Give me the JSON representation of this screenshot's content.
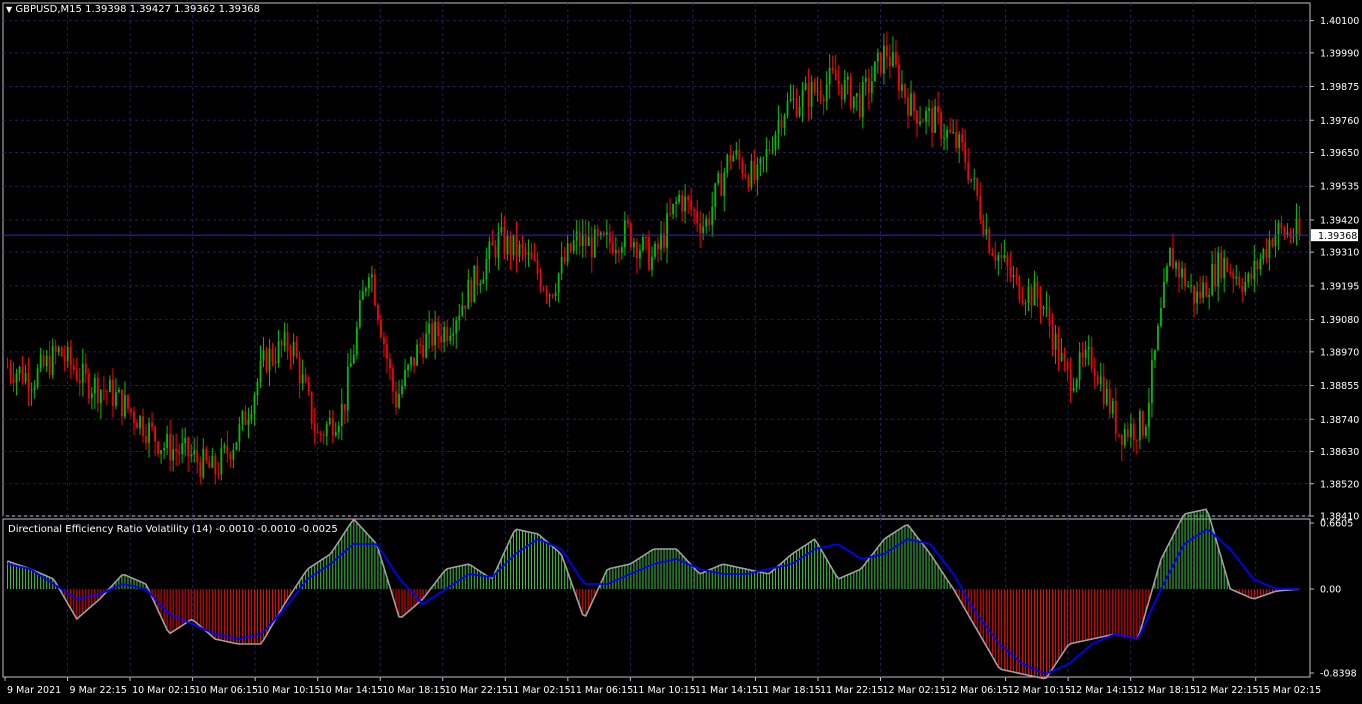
{
  "main_chart": {
    "symbol_label": "GBPUSD,M15",
    "ohlc_label": "1.39398 1.39427 1.39362 1.39368",
    "price_levels": [
      "1.40100",
      "1.39990",
      "1.39875",
      "1.39760",
      "1.39650",
      "1.39535",
      "1.39420",
      "1.39310",
      "1.39195",
      "1.39080",
      "1.38970",
      "1.38855",
      "1.38740",
      "1.38630",
      "1.38520",
      "1.38410"
    ],
    "current_price_label": "1.39368"
  },
  "indicator": {
    "title": "Directional Efficiency Ratio Volatility (14) -0.0010 -0.0010 -0.0025",
    "levels": [
      "0.6605",
      "0.00",
      "-0.8398"
    ]
  },
  "time_labels": [
    "9 Mar 2021",
    "9 Mar 22:15",
    "10 Mar 02:15",
    "10 Mar 06:15",
    "10 Mar 10:15",
    "10 Mar 14:15",
    "10 Mar 18:15",
    "10 Mar 22:15",
    "11 Mar 02:15",
    "11 Mar 06:15",
    "11 Mar 10:15",
    "11 Mar 14:15",
    "11 Mar 18:15",
    "11 Mar 22:15",
    "12 Mar 02:15",
    "12 Mar 06:15",
    "12 Mar 10:15",
    "12 Mar 14:15",
    "12 Mar 18:15",
    "12 Mar 22:15",
    "15 Mar 02:15"
  ],
  "colors": {
    "background": "#000000",
    "grid": "#1c1c6e",
    "bull_candle": "#00c000",
    "bear_candle": "#ff0000",
    "histogram_positive": "#32cd32",
    "histogram_negative": "#ff0000",
    "signal_line": "#0000ff",
    "ratio_line": "#a0a0a0",
    "bid_line": "#2b2bcf",
    "text": "#ffffff"
  },
  "chart_data": [
    {
      "type": "candlestick",
      "title": "GBPUSD,M15",
      "ylim": [
        1.3841,
        1.4016
      ],
      "x": [
        "9 Mar 2021",
        "9 Mar 22:15",
        "10 Mar 02:15",
        "10 Mar 06:15",
        "10 Mar 10:15",
        "10 Mar 14:15",
        "10 Mar 18:15",
        "10 Mar 22:15",
        "11 Mar 02:15",
        "11 Mar 06:15",
        "11 Mar 10:15",
        "11 Mar 14:15",
        "11 Mar 18:15",
        "11 Mar 22:15",
        "12 Mar 02:15",
        "12 Mar 06:15",
        "12 Mar 10:15",
        "12 Mar 14:15",
        "12 Mar 18:15",
        "12 Mar 22:15",
        "15 Mar 02:15"
      ],
      "close_path": [
        1.3892,
        1.3888,
        1.3897,
        1.3887,
        1.3883,
        1.3875,
        1.3865,
        1.3862,
        1.3856,
        1.387,
        1.3895,
        1.39,
        1.3868,
        1.3878,
        1.3928,
        1.388,
        1.39,
        1.3905,
        1.392,
        1.3935,
        1.393,
        1.3918,
        1.3935,
        1.3933,
        1.3938,
        1.3928,
        1.395,
        1.394,
        1.3965,
        1.3955,
        1.398,
        1.3985,
        1.399,
        1.3982,
        1.4,
        1.398,
        1.3975,
        1.3965,
        1.3935,
        1.392,
        1.3915,
        1.3888,
        1.3895,
        1.387,
        1.3872,
        1.393,
        1.3915,
        1.3928,
        1.392,
        1.3938,
        1.3937
      ],
      "current_price": 1.39368,
      "ohlc": {
        "open": 1.39398,
        "high": 1.39427,
        "low": 1.39362,
        "close": 1.39368
      }
    },
    {
      "type": "histogram",
      "title": "Directional Efficiency Ratio Volatility (14)",
      "ylim": [
        -0.8398,
        0.6605
      ],
      "values_shown": [
        -0.001,
        -0.001,
        -0.0025
      ],
      "ratio_path": [
        0.28,
        0.2,
        0.1,
        -0.3,
        -0.1,
        0.15,
        0.05,
        -0.45,
        -0.3,
        -0.5,
        -0.55,
        -0.55,
        -0.15,
        0.2,
        0.35,
        0.7,
        0.45,
        -0.3,
        -0.1,
        0.2,
        0.25,
        0.1,
        0.6,
        0.55,
        0.35,
        -0.3,
        0.2,
        0.25,
        0.4,
        0.4,
        0.15,
        0.25,
        0.2,
        0.15,
        0.35,
        0.5,
        0.1,
        0.2,
        0.5,
        0.65,
        0.35,
        0.0,
        -0.4,
        -0.8,
        -0.85,
        -0.9,
        -0.55,
        -0.5,
        -0.45,
        -0.5,
        0.3,
        0.75,
        0.8,
        0.0,
        -0.1,
        -0.02,
        0.0
      ],
      "signal_path": [
        0.25,
        0.2,
        0.05,
        -0.1,
        -0.05,
        0.05,
        0.0,
        -0.25,
        -0.35,
        -0.45,
        -0.5,
        -0.45,
        -0.2,
        0.1,
        0.25,
        0.45,
        0.45,
        0.1,
        -0.15,
        0.0,
        0.15,
        0.12,
        0.35,
        0.5,
        0.4,
        0.05,
        0.05,
        0.15,
        0.25,
        0.3,
        0.2,
        0.15,
        0.15,
        0.2,
        0.25,
        0.4,
        0.45,
        0.3,
        0.35,
        0.5,
        0.45,
        0.15,
        -0.25,
        -0.55,
        -0.75,
        -0.85,
        -0.75,
        -0.55,
        -0.45,
        -0.5,
        0.0,
        0.45,
        0.6,
        0.4,
        0.1,
        0.0,
        0.0
      ]
    }
  ]
}
